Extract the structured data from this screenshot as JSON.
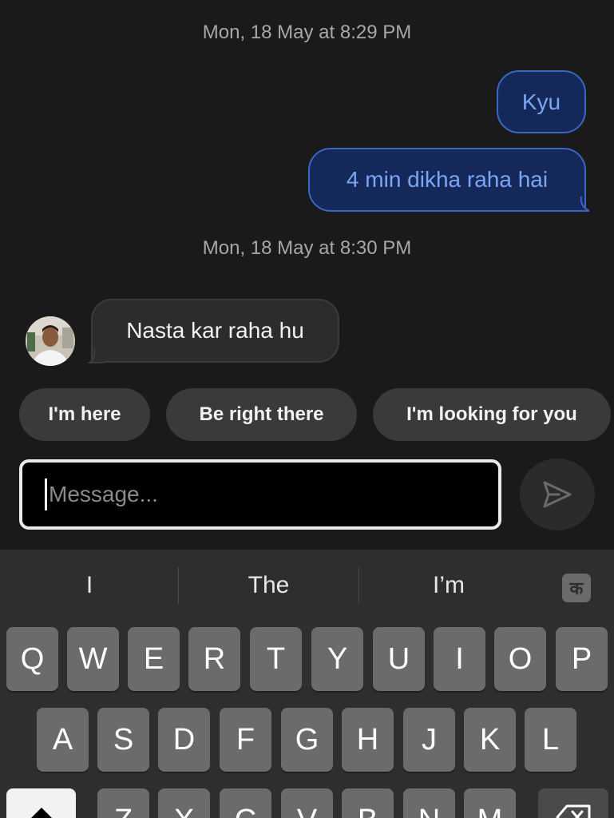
{
  "conversation": {
    "timestamps": [
      "Mon, 18 May at 8:29 PM",
      "Mon, 18 May at 8:30 PM"
    ],
    "outgoing": [
      "Kyu",
      "4 min dikha raha hai"
    ],
    "incoming": [
      "Nasta kar raha hu"
    ]
  },
  "quick_replies": [
    "I'm here",
    "Be right there",
    "I'm looking for you"
  ],
  "composer": {
    "placeholder": "Message...",
    "send_icon": "send-icon"
  },
  "keyboard": {
    "suggestions": [
      "I",
      "The",
      "I’m"
    ],
    "language_key": "क",
    "rows": [
      [
        "Q",
        "W",
        "E",
        "R",
        "T",
        "Y",
        "U",
        "I",
        "O",
        "P"
      ],
      [
        "A",
        "S",
        "D",
        "F",
        "G",
        "H",
        "J",
        "K",
        "L"
      ],
      [
        "Z",
        "X",
        "C",
        "V",
        "B",
        "N",
        "M"
      ]
    ]
  },
  "colors": {
    "background": "#1a1a1a",
    "outgoing_bubble": "#14295a",
    "outgoing_border": "#3a67c4",
    "outgoing_text": "#7aa6f5",
    "incoming_bubble": "#2c2c2c",
    "chip": "#3a3a3a",
    "keyboard": "#2e2e2e",
    "key": "#6b6b6b"
  }
}
